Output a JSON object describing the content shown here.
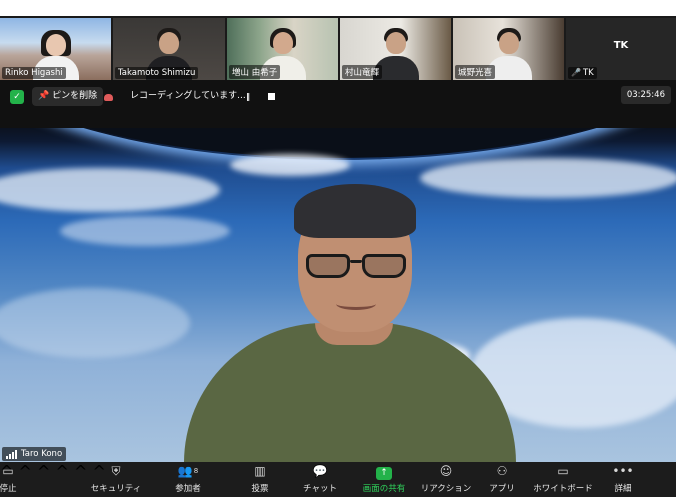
{
  "gallery": {
    "participants": [
      {
        "name": "Rinko Higashi"
      },
      {
        "name": "Takamoto Shimizu"
      },
      {
        "name": "増山 由希子"
      },
      {
        "name": "村山竜輝"
      },
      {
        "name": "城野光喜"
      },
      {
        "name": "TK",
        "initials": "TK",
        "muted": true
      }
    ]
  },
  "topbar": {
    "remove_pin_label": "ピンを削除",
    "recording_text": "レコーディングしています...",
    "pause_icon": "‖",
    "timer": "03:25:46"
  },
  "main_video": {
    "speaker_name": "Taro Kono"
  },
  "toolbar": {
    "items": [
      {
        "label": "停止",
        "icon": "stop-video-icon"
      },
      {
        "label": "セキュリティ",
        "icon": "shield-icon"
      },
      {
        "label": "参加者",
        "icon": "participants-icon",
        "count": "8"
      },
      {
        "label": "投票",
        "icon": "poll-icon"
      },
      {
        "label": "チャット",
        "icon": "chat-icon"
      },
      {
        "label": "画面の共有",
        "icon": "share-screen-icon"
      },
      {
        "label": "リアクション",
        "icon": "reaction-icon"
      },
      {
        "label": "アプリ",
        "icon": "apps-icon"
      },
      {
        "label": "ホワイトボード",
        "icon": "whiteboard-icon"
      },
      {
        "label": "詳細",
        "icon": "more-icon"
      }
    ]
  },
  "colors": {
    "accent_green": "#23b24a",
    "recording_red": "#e05b5b",
    "toolbar_bg": "#1c1c1c"
  }
}
